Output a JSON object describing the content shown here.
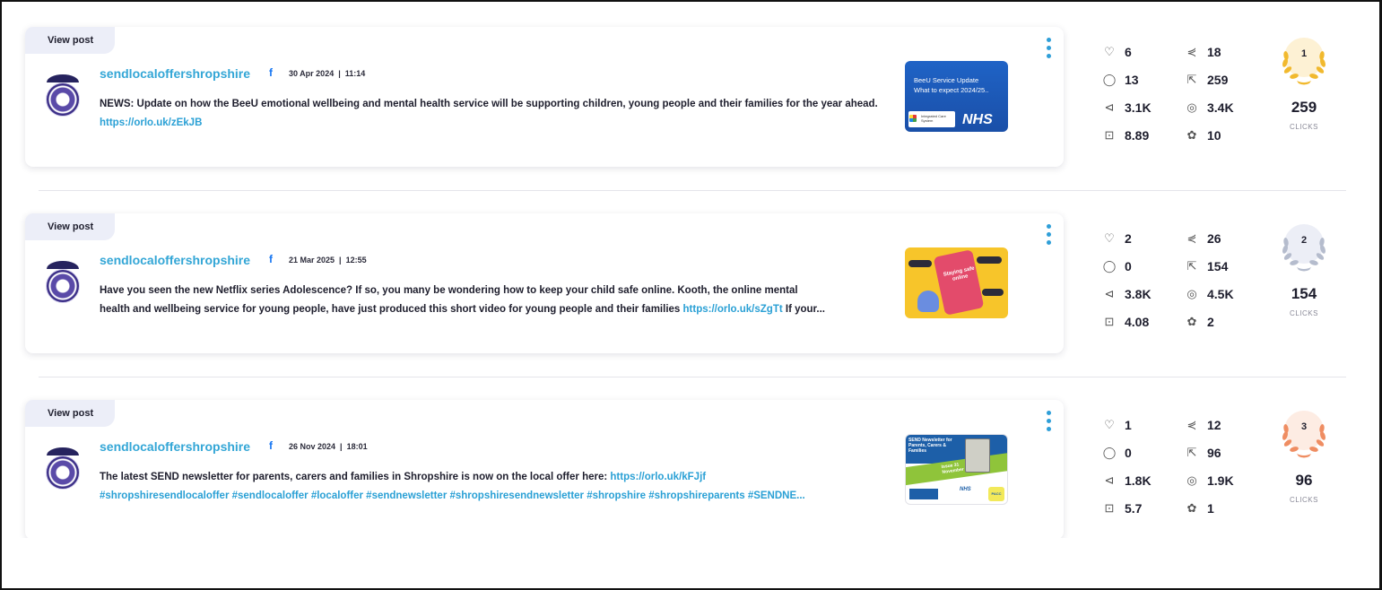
{
  "posts": [
    {
      "view_label": "View post",
      "author": "sendlocaloffershropshire",
      "network_icon": "facebook-icon",
      "date": "30 Apr 2024",
      "time": "11:14",
      "text": "NEWS: Update on how the BeeU emotional wellbeing and mental health service will be supporting children, young people and their families for the year ahead.",
      "link": "https://orlo.uk/zEkJB",
      "text_after": "",
      "hashtags": "",
      "thumbnail": {
        "line1": "BeeU Service Update",
        "line2": "What to expect 2024/25..",
        "logo": "NHS",
        "badge": "Integrated Care System"
      },
      "metrics": {
        "likes": "6",
        "comments": "13",
        "reach": "3.1K",
        "engagement": "8.89",
        "shares": "18",
        "clicks": "259",
        "impressions": "3.4K",
        "reactions": "10"
      },
      "rank": {
        "position": "1",
        "value": "259",
        "label": "CLICKS",
        "color": "#f1b92e",
        "bg": "#fdf1d4"
      }
    },
    {
      "view_label": "View post",
      "author": "sendlocaloffershropshire",
      "network_icon": "facebook-icon",
      "date": "21 Mar 2025",
      "time": "12:55",
      "text_line1": "Have you seen the new Netflix series Adolescence? If so, you many be wondering how to keep your child safe online. Kooth, the online mental",
      "text_line2_a": "health and wellbeing service for young people, have just produced this short video for young people and their families",
      "link": "https://orlo.uk/sZgTt",
      "text_after": "If your...",
      "thumbnail": {
        "line1": "Staying safe online"
      },
      "metrics": {
        "likes": "2",
        "comments": "0",
        "reach": "3.8K",
        "engagement": "4.08",
        "shares": "26",
        "clicks": "154",
        "impressions": "4.5K",
        "reactions": "2"
      },
      "rank": {
        "position": "2",
        "value": "154",
        "label": "CLICKS",
        "color": "#b5bccd",
        "bg": "#eceef6"
      }
    },
    {
      "view_label": "View post",
      "author": "sendlocaloffershropshire",
      "network_icon": "facebook-icon",
      "date": "26 Nov 2024",
      "time": "18:01",
      "text": "The latest SEND newsletter for parents, carers and families in Shropshire is now on the local offer here:",
      "link": "https://orlo.uk/kFJjf",
      "hashtags": "#shropshiresendlocaloffer #sendlocaloffer #localoffer #sendnewsletter #shropshiresendnewsletter #shropshire #shropshireparents #SENDNE...",
      "thumbnail": {
        "line1": "SEND Newsletter for Parents, Carers & Families",
        "line2": "Issue 31 November 2024",
        "logo": "NHS",
        "badge": "PACC"
      },
      "metrics": {
        "likes": "1",
        "comments": "0",
        "reach": "1.8K",
        "engagement": "5.7",
        "shares": "12",
        "clicks": "96",
        "impressions": "1.9K",
        "reactions": "1"
      },
      "rank": {
        "position": "3",
        "value": "96",
        "label": "CLICKS",
        "color": "#ef8d62",
        "bg": "#fdece3"
      }
    }
  ],
  "icons": {
    "likes": "heart-icon",
    "comments": "comment-icon",
    "reach": "megaphone-icon",
    "engagement": "trend-chart-icon",
    "shares": "share-icon",
    "clicks": "cursor-click-icon",
    "impressions": "eye-icon",
    "reactions": "reactions-icon",
    "menu": "kebab-menu-icon"
  }
}
